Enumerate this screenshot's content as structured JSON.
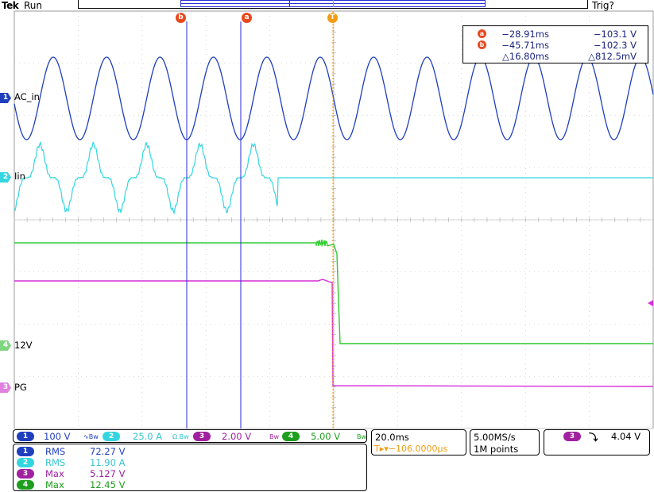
{
  "header": {
    "brand": "Tek",
    "run_state": "Run",
    "trigger_state": "Trig?"
  },
  "colors": {
    "ch1": "#1f3fbf",
    "ch2": "#33d6e0",
    "ch3": "#d62ed6",
    "ch4": "#2ecc2e",
    "cursor": "#2a2ad8",
    "trigger": "#f39c12",
    "cursor_badge": "#e8491d"
  },
  "cursors": {
    "a": {
      "badge": "a",
      "time": "−28.91ms",
      "value": "−103.1 V"
    },
    "b": {
      "badge": "b",
      "time": "−45.71ms",
      "value": "−102.3 V"
    },
    "delta": {
      "time": "△16.80ms",
      "value": "△812.5mV"
    }
  },
  "trigger_tab": "T",
  "channels": [
    {
      "num": "1",
      "label": "AC_in"
    },
    {
      "num": "2",
      "label": "Iin"
    },
    {
      "num": "4",
      "label": "12V"
    },
    {
      "num": "3",
      "label": "PG"
    }
  ],
  "vertical_settings": [
    {
      "num": "1",
      "scale": "100 V",
      "suffix": "∿Bw"
    },
    {
      "num": "2",
      "scale": "25.0 A",
      "suffix": "Ω Bw"
    },
    {
      "num": "3",
      "scale": "2.00 V",
      "suffix": "Bw"
    },
    {
      "num": "4",
      "scale": "5.00 V",
      "suffix": "Bw"
    }
  ],
  "measurements": [
    {
      "num": "1",
      "type": "RMS",
      "value": "72.27 V"
    },
    {
      "num": "2",
      "type": "RMS",
      "value": "11.90 A"
    },
    {
      "num": "3",
      "type": "Max",
      "value": "5.127 V"
    },
    {
      "num": "4",
      "type": "Max",
      "value": "12.45 V"
    }
  ],
  "timebase": {
    "scale": "20.0ms",
    "position": "T▸▾−106.0000µs"
  },
  "acquisition": {
    "rate": "5.00MS/s",
    "record": "1M points"
  },
  "trigger": {
    "channel": "3",
    "slope": "⤵",
    "level": "4.04 V"
  }
}
